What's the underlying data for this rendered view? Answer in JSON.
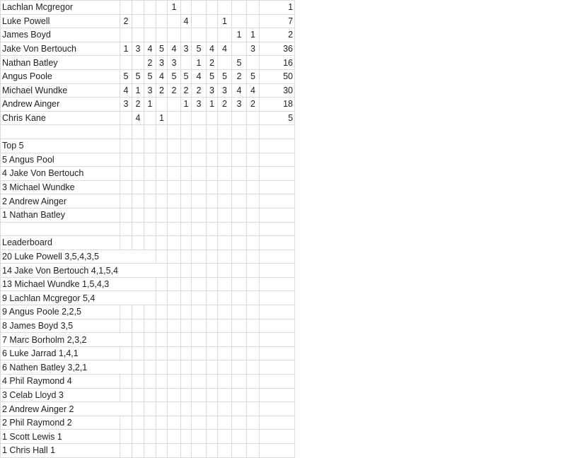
{
  "scores": {
    "rows": [
      {
        "name": "Lachlan Mcgregor",
        "cells": [
          "",
          "",
          "",
          "",
          "1",
          "",
          "",
          "",
          "",
          "",
          ""
        ],
        "total": "1"
      },
      {
        "name": "Luke Powell",
        "cells": [
          "2",
          "",
          "",
          "",
          "",
          "4",
          "",
          "",
          "1",
          "",
          ""
        ],
        "total": "7"
      },
      {
        "name": "James Boyd",
        "cells": [
          "",
          "",
          "",
          "",
          "",
          "",
          "",
          "",
          "",
          "1",
          "1"
        ],
        "total": "2"
      },
      {
        "name": "Jake Von Bertouch",
        "cells": [
          "1",
          "3",
          "4",
          "5",
          "4",
          "3",
          "5",
          "4",
          "4",
          "",
          "3"
        ],
        "total": "36"
      },
      {
        "name": "Nathan Batley",
        "cells": [
          "",
          "",
          "2",
          "3",
          "3",
          "",
          "1",
          "2",
          "",
          "5",
          ""
        ],
        "total": "16"
      },
      {
        "name": "Angus Poole",
        "cells": [
          "5",
          "5",
          "5",
          "4",
          "5",
          "5",
          "4",
          "5",
          "5",
          "2",
          "5"
        ],
        "total": "50"
      },
      {
        "name": "Michael Wundke",
        "cells": [
          "4",
          "1",
          "3",
          "2",
          "2",
          "2",
          "2",
          "3",
          "3",
          "4",
          "4"
        ],
        "total": "30"
      },
      {
        "name": "Andrew Ainger",
        "cells": [
          "3",
          "2",
          "1",
          "",
          "",
          "1",
          "3",
          "1",
          "2",
          "3",
          "2"
        ],
        "total": "18"
      },
      {
        "name": "Chris Kane",
        "cells": [
          "",
          "4",
          "",
          "1",
          "",
          "",
          "",
          "",
          "",
          "",
          ""
        ],
        "total": "5"
      }
    ]
  },
  "top5": {
    "title": "Top 5",
    "items": [
      "5 Angus Pool",
      "4 Jake Von Bertouch",
      "3 Michael Wundke",
      "2 Andrew Ainger",
      "1 Nathan Batley"
    ]
  },
  "leaderboard": {
    "title": "Leaderboard",
    "items": [
      "20 Luke Powell 3,5,4,3,5",
      "14 Jake Von Bertouch 4,1,5,4",
      "13 Michael Wundke 1,5,4,3",
      "9 Lachlan Mcgregor 5,4",
      "9 Angus Poole 2,2,5",
      "8 James Boyd 3,5",
      "7 Marc Borholm 2,3,2",
      "6 Luke Jarrad 1,4,1",
      "6 Nathen Batley 3,2,1",
      "4 Phil Raymond 4",
      "3 Celab Lloyd 3",
      "2 Andrew Ainger 2",
      "2 Phil Raymond 2",
      "1 Scott Lewis 1",
      "1 Chris Hall 1"
    ]
  }
}
